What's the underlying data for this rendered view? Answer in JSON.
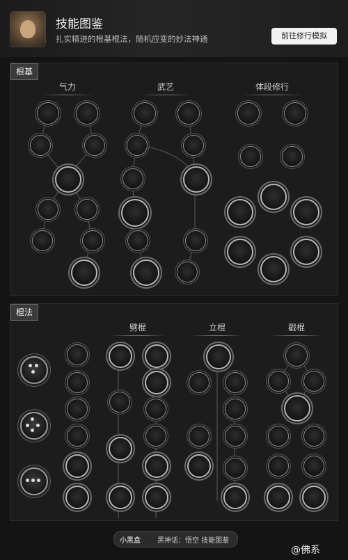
{
  "header": {
    "title": "技能图鉴",
    "subtitle": "扎实精进的根基棍法，随机应变的妙法神通",
    "simulate_button": "前往修行模拟"
  },
  "foundation": {
    "tag": "根基",
    "columns": [
      "气力",
      "武艺",
      "体段修行"
    ]
  },
  "staff": {
    "tag": "棍法",
    "columns": [
      "劈棍",
      "立棍",
      "戳棍"
    ]
  },
  "footer": {
    "logo": "小黑盒",
    "search": "黑神话：悟空 技能图鉴"
  },
  "watermark": "@佛系"
}
